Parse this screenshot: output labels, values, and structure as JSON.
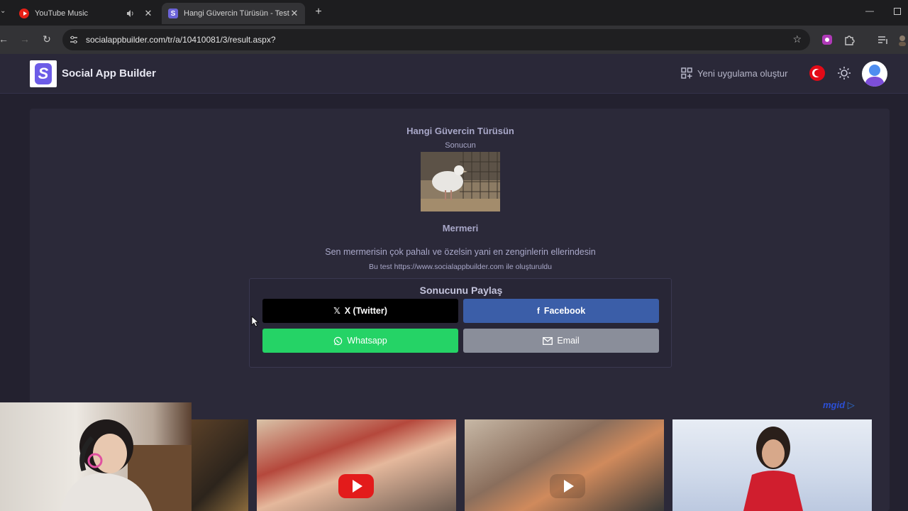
{
  "browser": {
    "tabs": [
      {
        "title": "YouTube Music",
        "icon": "youtube-music-icon",
        "active": false
      },
      {
        "title": "Hangi Güvercin Türüsün - Test",
        "icon": "social-app-builder-icon",
        "active": true
      }
    ],
    "url": "socialappbuilder.com/tr/a/10410081/3/result.aspx?"
  },
  "site": {
    "brand": "Social App Builder",
    "new_app_label": "Yeni uygulama oluştur"
  },
  "quiz": {
    "title": "Hangi Güvercin Türüsün",
    "result_label": "Sonucun",
    "result_name": "Mermeri",
    "result_description": "Sen mermerisin çok pahalı ve özelsin yani en zenginlerin ellerindesin",
    "made_with": "Bu test https://www.socialappbuilder.com ile oluşturuldu"
  },
  "share": {
    "title": "Sonucunu Paylaş",
    "twitter_label": "X (Twitter)",
    "facebook_label": "Facebook",
    "whatsapp_label": "Whatsapp",
    "email_label": "Email"
  },
  "ads": {
    "brand": "mgid"
  },
  "colors": {
    "page_bg": "#23212f",
    "card_bg": "#2b2939",
    "twitter": "#000000",
    "facebook": "#3b5ea8",
    "whatsapp": "#25d366",
    "email": "#8a8e9a"
  }
}
